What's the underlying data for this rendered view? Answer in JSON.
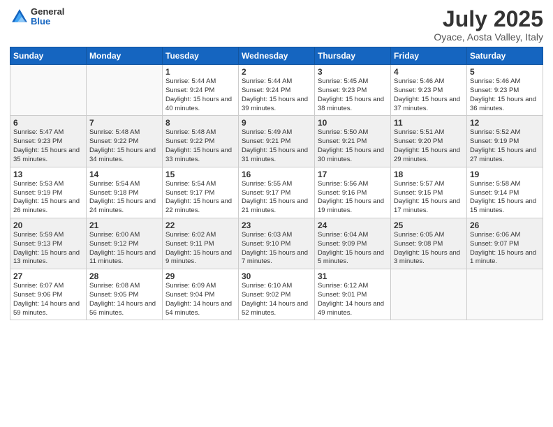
{
  "header": {
    "logo_general": "General",
    "logo_blue": "Blue",
    "title": "July 2025",
    "location": "Oyace, Aosta Valley, Italy"
  },
  "weekdays": [
    "Sunday",
    "Monday",
    "Tuesday",
    "Wednesday",
    "Thursday",
    "Friday",
    "Saturday"
  ],
  "weeks": [
    [
      {
        "day": "",
        "info": ""
      },
      {
        "day": "",
        "info": ""
      },
      {
        "day": "1",
        "info": "Sunrise: 5:44 AM\nSunset: 9:24 PM\nDaylight: 15 hours\nand 40 minutes."
      },
      {
        "day": "2",
        "info": "Sunrise: 5:44 AM\nSunset: 9:24 PM\nDaylight: 15 hours\nand 39 minutes."
      },
      {
        "day": "3",
        "info": "Sunrise: 5:45 AM\nSunset: 9:23 PM\nDaylight: 15 hours\nand 38 minutes."
      },
      {
        "day": "4",
        "info": "Sunrise: 5:46 AM\nSunset: 9:23 PM\nDaylight: 15 hours\nand 37 minutes."
      },
      {
        "day": "5",
        "info": "Sunrise: 5:46 AM\nSunset: 9:23 PM\nDaylight: 15 hours\nand 36 minutes."
      }
    ],
    [
      {
        "day": "6",
        "info": "Sunrise: 5:47 AM\nSunset: 9:23 PM\nDaylight: 15 hours\nand 35 minutes."
      },
      {
        "day": "7",
        "info": "Sunrise: 5:48 AM\nSunset: 9:22 PM\nDaylight: 15 hours\nand 34 minutes."
      },
      {
        "day": "8",
        "info": "Sunrise: 5:48 AM\nSunset: 9:22 PM\nDaylight: 15 hours\nand 33 minutes."
      },
      {
        "day": "9",
        "info": "Sunrise: 5:49 AM\nSunset: 9:21 PM\nDaylight: 15 hours\nand 31 minutes."
      },
      {
        "day": "10",
        "info": "Sunrise: 5:50 AM\nSunset: 9:21 PM\nDaylight: 15 hours\nand 30 minutes."
      },
      {
        "day": "11",
        "info": "Sunrise: 5:51 AM\nSunset: 9:20 PM\nDaylight: 15 hours\nand 29 minutes."
      },
      {
        "day": "12",
        "info": "Sunrise: 5:52 AM\nSunset: 9:19 PM\nDaylight: 15 hours\nand 27 minutes."
      }
    ],
    [
      {
        "day": "13",
        "info": "Sunrise: 5:53 AM\nSunset: 9:19 PM\nDaylight: 15 hours\nand 26 minutes."
      },
      {
        "day": "14",
        "info": "Sunrise: 5:54 AM\nSunset: 9:18 PM\nDaylight: 15 hours\nand 24 minutes."
      },
      {
        "day": "15",
        "info": "Sunrise: 5:54 AM\nSunset: 9:17 PM\nDaylight: 15 hours\nand 22 minutes."
      },
      {
        "day": "16",
        "info": "Sunrise: 5:55 AM\nSunset: 9:17 PM\nDaylight: 15 hours\nand 21 minutes."
      },
      {
        "day": "17",
        "info": "Sunrise: 5:56 AM\nSunset: 9:16 PM\nDaylight: 15 hours\nand 19 minutes."
      },
      {
        "day": "18",
        "info": "Sunrise: 5:57 AM\nSunset: 9:15 PM\nDaylight: 15 hours\nand 17 minutes."
      },
      {
        "day": "19",
        "info": "Sunrise: 5:58 AM\nSunset: 9:14 PM\nDaylight: 15 hours\nand 15 minutes."
      }
    ],
    [
      {
        "day": "20",
        "info": "Sunrise: 5:59 AM\nSunset: 9:13 PM\nDaylight: 15 hours\nand 13 minutes."
      },
      {
        "day": "21",
        "info": "Sunrise: 6:00 AM\nSunset: 9:12 PM\nDaylight: 15 hours\nand 11 minutes."
      },
      {
        "day": "22",
        "info": "Sunrise: 6:02 AM\nSunset: 9:11 PM\nDaylight: 15 hours\nand 9 minutes."
      },
      {
        "day": "23",
        "info": "Sunrise: 6:03 AM\nSunset: 9:10 PM\nDaylight: 15 hours\nand 7 minutes."
      },
      {
        "day": "24",
        "info": "Sunrise: 6:04 AM\nSunset: 9:09 PM\nDaylight: 15 hours\nand 5 minutes."
      },
      {
        "day": "25",
        "info": "Sunrise: 6:05 AM\nSunset: 9:08 PM\nDaylight: 15 hours\nand 3 minutes."
      },
      {
        "day": "26",
        "info": "Sunrise: 6:06 AM\nSunset: 9:07 PM\nDaylight: 15 hours\nand 1 minute."
      }
    ],
    [
      {
        "day": "27",
        "info": "Sunrise: 6:07 AM\nSunset: 9:06 PM\nDaylight: 14 hours\nand 59 minutes."
      },
      {
        "day": "28",
        "info": "Sunrise: 6:08 AM\nSunset: 9:05 PM\nDaylight: 14 hours\nand 56 minutes."
      },
      {
        "day": "29",
        "info": "Sunrise: 6:09 AM\nSunset: 9:04 PM\nDaylight: 14 hours\nand 54 minutes."
      },
      {
        "day": "30",
        "info": "Sunrise: 6:10 AM\nSunset: 9:02 PM\nDaylight: 14 hours\nand 52 minutes."
      },
      {
        "day": "31",
        "info": "Sunrise: 6:12 AM\nSunset: 9:01 PM\nDaylight: 14 hours\nand 49 minutes."
      },
      {
        "day": "",
        "info": ""
      },
      {
        "day": "",
        "info": ""
      }
    ]
  ]
}
